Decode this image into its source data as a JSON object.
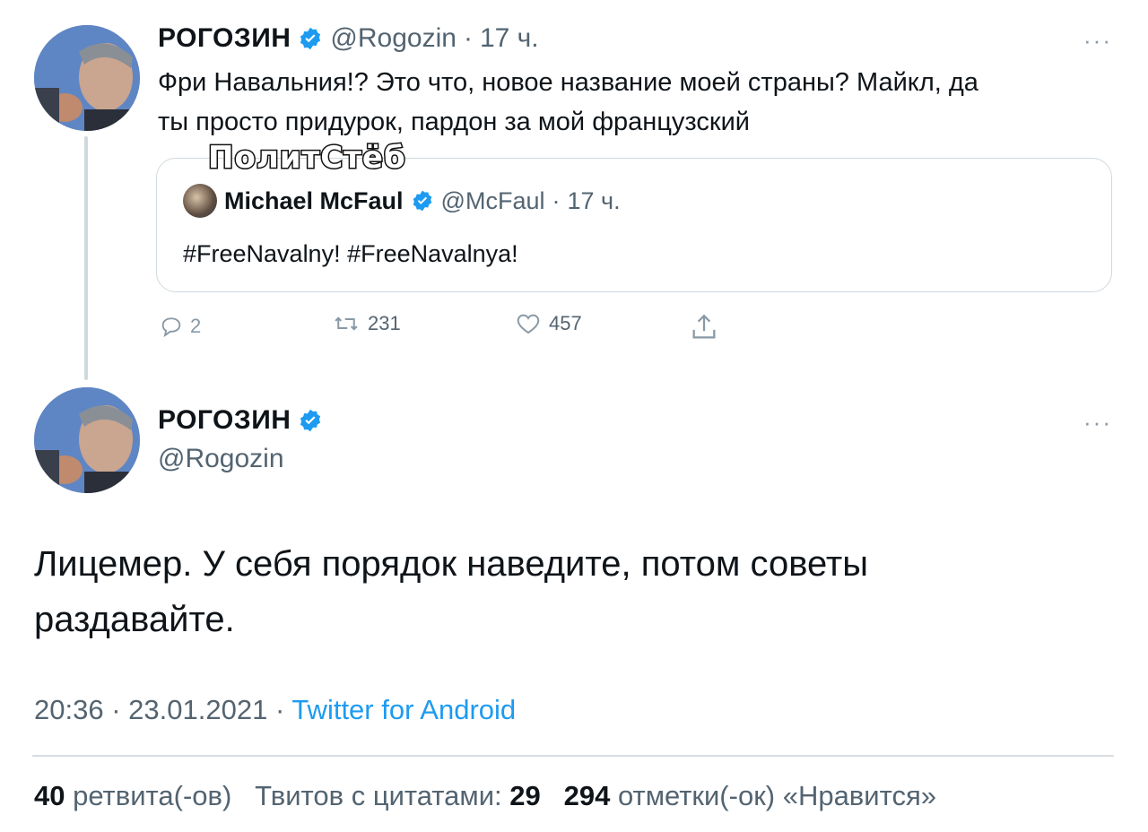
{
  "quoted_reply": {
    "author_name": "РОГОЗИН",
    "author_handle": "@Rogozin",
    "time": "17 ч.",
    "text_line1": "Фри Навальния!? Это что, новое название моей страны? Майкл, да",
    "text_line2": "ты просто придурок, пардон за мой французский",
    "more_icon": "more-horizontal-icon"
  },
  "quoted_tweet": {
    "author_name": "Michael McFaul",
    "author_handle": "@McFaul",
    "time": "17 ч.",
    "text": "#FreeNavalny! #FreeNavalnya!"
  },
  "actions": {
    "replies": "2",
    "retweets": "231",
    "likes": "457"
  },
  "watermark": "ПолитСтёб",
  "main_tweet": {
    "author_name": "РОГОЗИН",
    "author_handle": "@Rogozin",
    "text_line1": "Лицемер. У себя порядок наведите, потом советы",
    "text_line2": "раздавайте.",
    "time": "20:36",
    "date": "23.01.2021",
    "source": "Twitter for Android",
    "separator": "·"
  },
  "stats": {
    "retweets_count": "40",
    "retweets_label": "ретвита(-ов)",
    "quotes_label": "Твитов с цитатами:",
    "quotes_count": "29",
    "likes_count": "294",
    "likes_label": "отметки(-ок) «Нравится»"
  },
  "colors": {
    "verified": "#1d9bf0",
    "link": "#1d9bf0",
    "secondary_text": "#536471",
    "border": "#cfd9de"
  }
}
